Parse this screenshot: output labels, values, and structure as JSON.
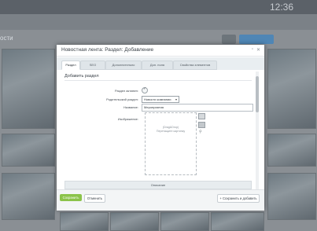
{
  "background": {
    "clock": "12:36",
    "page_heading": "ости"
  },
  "modal": {
    "title": "Новостная лента: Раздел: Добавление",
    "tabs": [
      {
        "label": "Раздел"
      },
      {
        "label": "SEO"
      },
      {
        "label": "Дополнительно"
      },
      {
        "label": "Доп. поля"
      },
      {
        "label": "Свойства элементов"
      }
    ],
    "section_title": "Добавить раздел",
    "form": {
      "active_label": "Раздел активен:",
      "parent_label": "Родительский раздел:",
      "parent_value": "Новости компании",
      "name_label": "Название:",
      "name_value": "Мероприятия",
      "image_label": "Изображение:",
      "dropzone_line1": "(Drag&Drop)",
      "dropzone_line2": "Перетащите картинку"
    },
    "description_bar": "Описание",
    "footer": {
      "save": "Сохранить",
      "cancel": "Отменить",
      "save_and_add": "+ Сохранить и добавить"
    }
  },
  "colors": {
    "save_button": "#8bc34a",
    "modal_bg": "#ffffff",
    "overlay": "#6f7378"
  }
}
